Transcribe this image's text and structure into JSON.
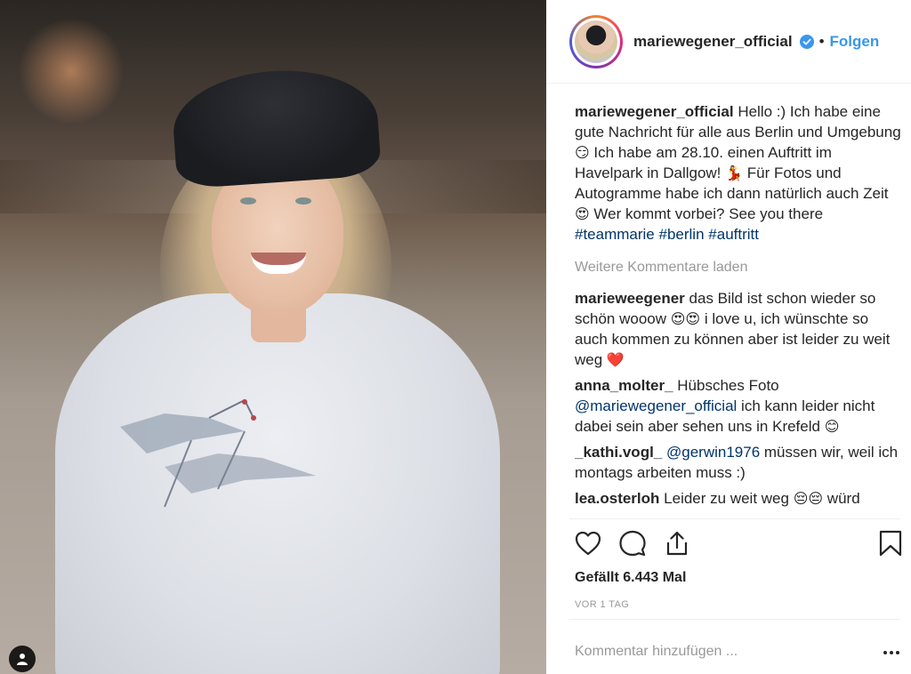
{
  "post": {
    "username": "mariewegener_official",
    "follow_label": "Folgen",
    "separator": "•"
  },
  "caption": {
    "user": "mariewegener_official",
    "text_1": "Hello :) Ich habe eine gute Nachricht für alle aus Berlin und Umgebung",
    "emoji_1": "😏",
    "text_2": "Ich habe am 28.10. einen Auftritt im Havelpark in Dallgow!",
    "emoji_2": "💃",
    "text_3": "Für Fotos und Autogramme habe ich dann natürlich auch Zeit",
    "emoji_3": "😍",
    "text_4": "Wer kommt vorbei? See you there",
    "hashtags": [
      "#teammarie",
      "#berlin",
      "#auftritt"
    ]
  },
  "load_more_label": "Weitere Kommentare laden",
  "comments": [
    {
      "user": "marieweegener",
      "text_1": "das Bild ist schon wieder so schön wooow",
      "emoji_1": "😍😍",
      "text_2": "i love u, ich wünschte so auch kommen zu können aber ist leider zu weit weg",
      "emoji_2": "❤️"
    },
    {
      "user": "anna_molter_",
      "text_1": "Hübsches Foto",
      "mention": "@mariewegener_official",
      "text_2": "ich kann leider nicht dabei sein aber sehen uns in Krefeld",
      "emoji_1": "😊"
    },
    {
      "user": "_kathi.vogl_",
      "mention": "@gerwin1976",
      "text_1": "müssen wir, weil ich montags arbeiten muss :)"
    },
    {
      "user": "lea.osterloh",
      "text_1": "Leider zu weit weg",
      "emoji_1": "😔😔",
      "text_2": "würd"
    }
  ],
  "likes_label": "Gefällt 6.443 Mal",
  "timestamp": "VOR 1 TAG",
  "comment_placeholder": "Kommentar hinzufügen ...",
  "icons": {
    "like": "heart-icon",
    "comment": "comment-icon",
    "share": "share-icon",
    "save": "bookmark-icon",
    "verified": "verified-badge-icon",
    "user_tags": "user-tag-icon",
    "more": "more-options-icon"
  },
  "colors": {
    "link": "#3897f0",
    "hashtag": "#003569",
    "muted": "#999999",
    "text": "#262626",
    "verified": "#3897f0"
  }
}
